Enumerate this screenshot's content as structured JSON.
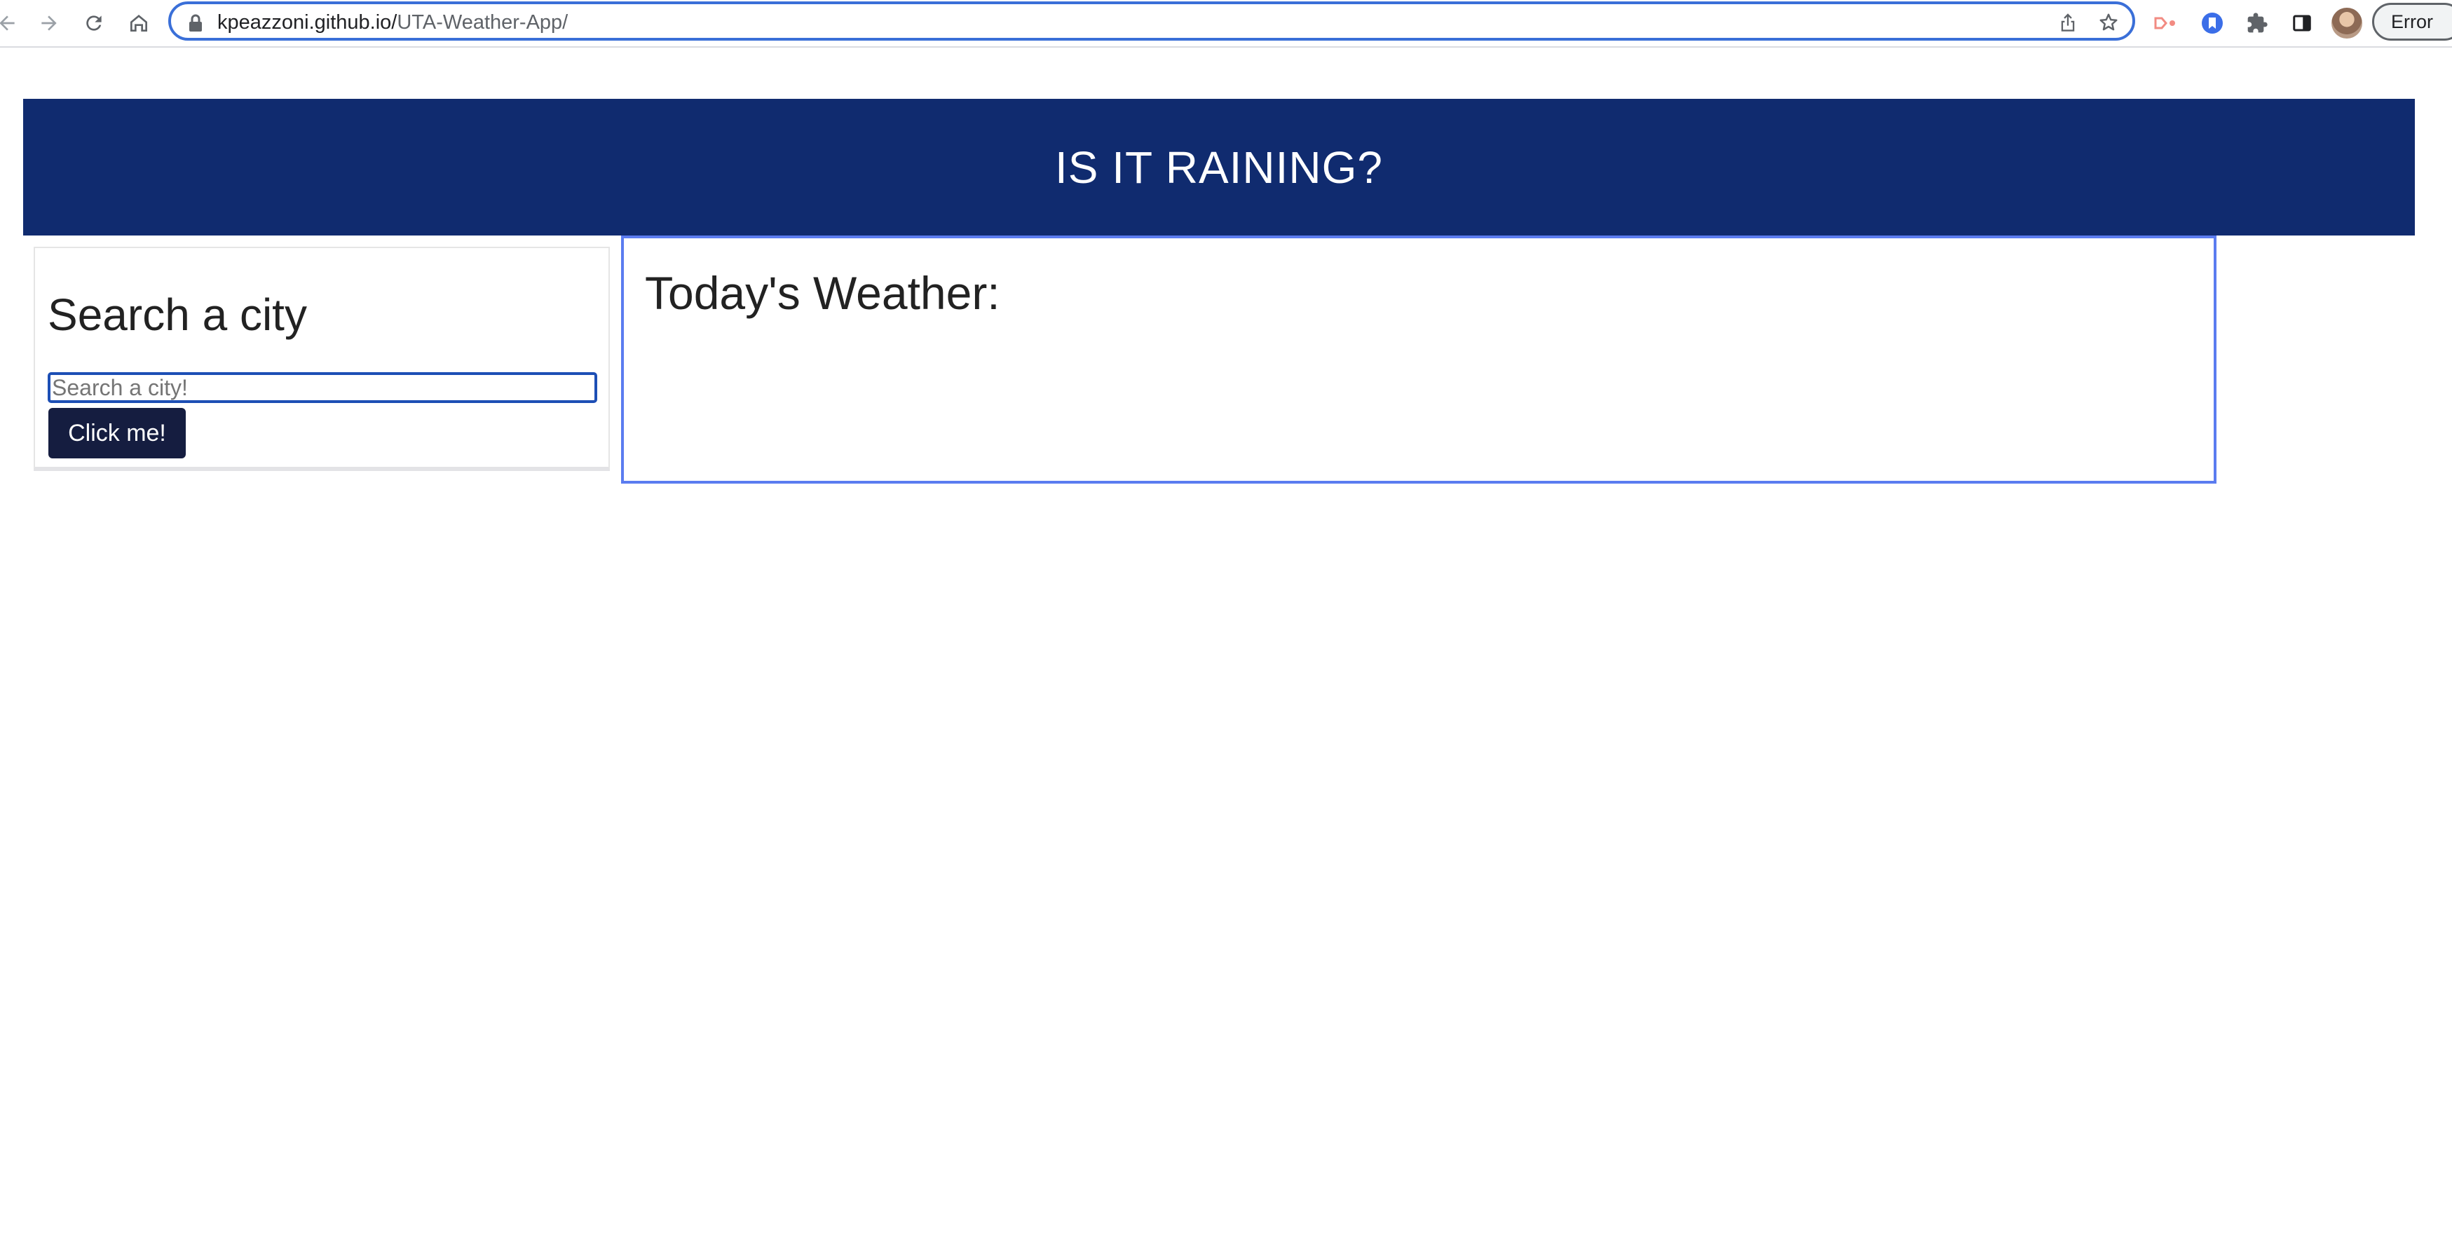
{
  "browser": {
    "url_host": "kpeazzoni.github.io/",
    "url_path": "UTA-Weather-App/",
    "error_label": "Error",
    "icons": [
      "back-icon",
      "forward-icon",
      "reload-icon",
      "home-icon",
      "lock-icon",
      "share-icon",
      "bookmark-star-icon",
      "extension-icon",
      "tab-search-icon",
      "puzzle-icon",
      "side-panel-icon",
      "avatar"
    ]
  },
  "header": {
    "title": "IS IT RAINING?"
  },
  "search": {
    "title": "Search a city",
    "placeholder": "Search a city!",
    "button_label": "Click me!"
  },
  "weather": {
    "title": "Today's Weather:"
  },
  "colors": {
    "header_bg": "#102b6f",
    "button_bg": "#151d40",
    "focus_border": "#1d4fb5",
    "weather_border": "#5b7cf0"
  }
}
